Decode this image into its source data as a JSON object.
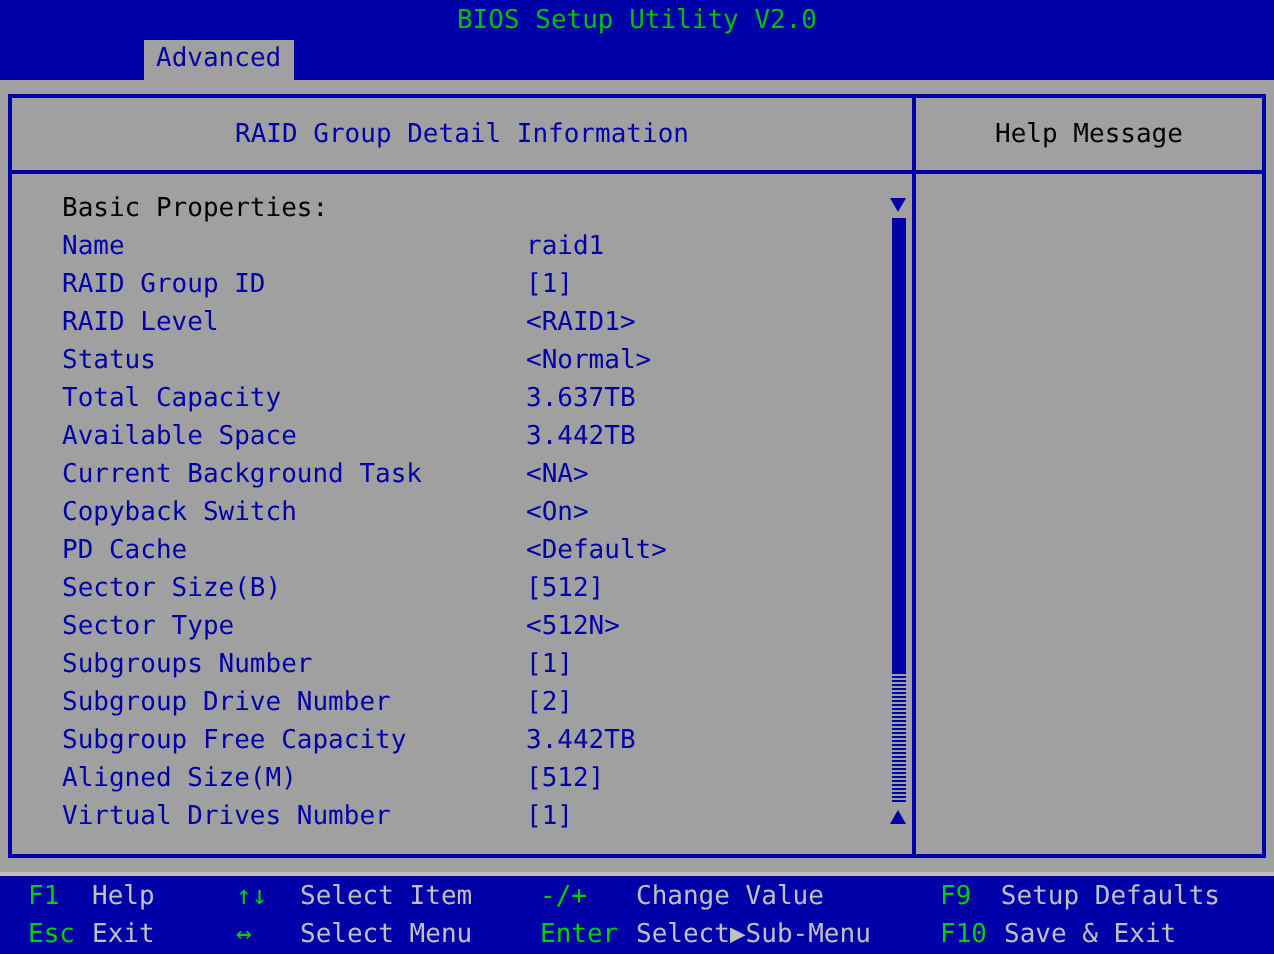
{
  "window": {
    "title": "BIOS Setup Utility V2.0"
  },
  "tabs": [
    {
      "label": "Advanced",
      "selected": true
    }
  ],
  "panel": {
    "title": "RAID Group Detail Information",
    "section": "Basic Properties:",
    "rows": [
      {
        "label": "Name",
        "value": "raid1"
      },
      {
        "label": "RAID Group ID",
        "value": "[1]"
      },
      {
        "label": "RAID Level",
        "value": "<RAID1>"
      },
      {
        "label": "Status",
        "value": "<Normal>"
      },
      {
        "label": "Total Capacity",
        "value": "3.637TB"
      },
      {
        "label": "Available Space",
        "value": "3.442TB"
      },
      {
        "label": "Current Background Task",
        "value": "<NA>"
      },
      {
        "label": "Copyback Switch",
        "value": "<On>"
      },
      {
        "label": "PD Cache",
        "value": "<Default>"
      },
      {
        "label": "Sector Size(B)",
        "value": "[512]"
      },
      {
        "label": "Sector Type",
        "value": "<512N>"
      },
      {
        "label": "Subgroups Number",
        "value": "[1]"
      },
      {
        "label": "Subgroup Drive Number",
        "value": "[2]"
      },
      {
        "label": "Subgroup Free Capacity",
        "value": "3.442TB"
      },
      {
        "label": "Aligned Size(M)",
        "value": "[512]"
      },
      {
        "label": "Virtual Drives Number",
        "value": "[1]"
      }
    ]
  },
  "help": {
    "title": "Help Message"
  },
  "footer": [
    [
      {
        "key": "F1",
        "action": "Help"
      },
      {
        "key": "↑↓",
        "action": "Select Item"
      },
      {
        "key": "-/+",
        "action": "Change Value"
      },
      {
        "key": "F9",
        "action": "Setup Defaults"
      }
    ],
    [
      {
        "key": "Esc",
        "action": "Exit"
      },
      {
        "key": "↔",
        "action": "Select Menu"
      },
      {
        "key": "Enter",
        "action": "Select▶Sub-Menu"
      },
      {
        "key": "F10",
        "action": "Save & Exit"
      }
    ]
  ]
}
